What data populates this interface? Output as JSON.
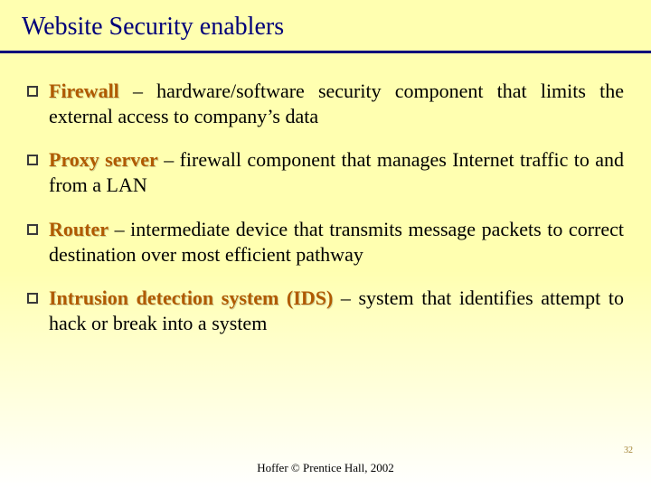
{
  "title": "Website Security enablers",
  "items": [
    {
      "term": "Firewall",
      "desc": " – hardware/software security component that limits the external access to company’s data"
    },
    {
      "term": "Proxy server",
      "desc": " – firewall component that manages Internet traffic to and from a LAN"
    },
    {
      "term": "Router",
      "desc": " – intermediate device that transmits message packets to correct destination over most efficient pathway"
    },
    {
      "term": "Intrusion detection system (IDS)",
      "desc": " – system that identifies attempt to hack or break into a system"
    }
  ],
  "slide_number": "32",
  "footer": "Hoffer © Prentice Hall, 2002"
}
